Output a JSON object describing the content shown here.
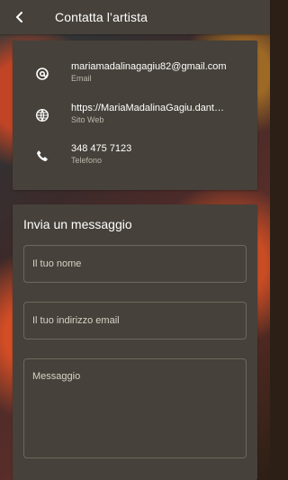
{
  "header": {
    "title": "Contatta l’artista",
    "back_icon": "arrow-back-icon"
  },
  "contacts": [
    {
      "icon": "at-sign-icon",
      "value": "mariamadalinagagiu82@gmail.com",
      "label": "Email"
    },
    {
      "icon": "globe-icon",
      "value": "https://MariaMadalinaGagiu.dant…",
      "label": "Sito Web"
    },
    {
      "icon": "phone-icon",
      "value": "348 475 7123",
      "label": "Telefono"
    }
  ],
  "message_form": {
    "title": "Invia un messaggio",
    "name_placeholder": "Il tuo nome",
    "email_placeholder": "Il tuo indirizzo email",
    "message_placeholder": "Messaggio"
  },
  "colors": {
    "surface": "#46413a",
    "text": "#ffffff",
    "muted_text": "#bdb6ab",
    "field_border": "#6f675d"
  }
}
